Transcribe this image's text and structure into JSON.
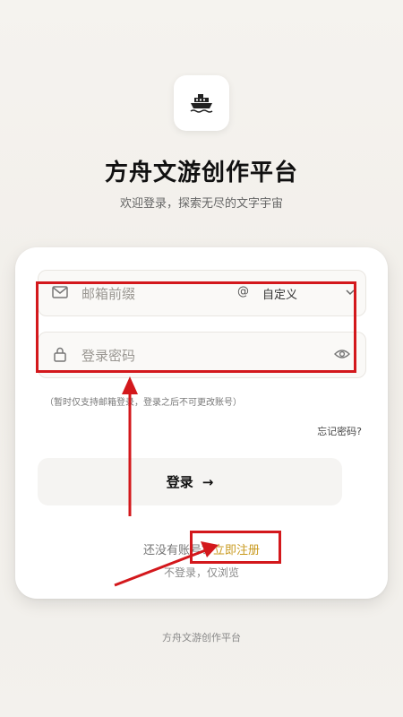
{
  "app": {
    "logo_icon": "ship-icon",
    "title": "方舟文游创作平台",
    "subtitle": "欢迎登录，探索无尽的文字宇宙"
  },
  "form": {
    "email_placeholder": "邮箱前缀",
    "email_icon": "mail-icon",
    "at_sign": "@",
    "domain_selected": "自定义",
    "password_placeholder": "登录密码",
    "password_icon": "lock-icon",
    "visibility_icon": "eye-icon",
    "hint": "（暂时仅支持邮箱登录，登录之后不可更改账号）",
    "forgot": "忘记密码?",
    "login_label": "登录",
    "login_arrow": "→"
  },
  "register": {
    "prompt": "还没有账号？",
    "link": "立即注册"
  },
  "guest": "不登录，仅浏览",
  "footer": "方舟文游创作平台",
  "colors": {
    "annotation_red": "#d3181c",
    "register_link": "#c99a1f"
  }
}
